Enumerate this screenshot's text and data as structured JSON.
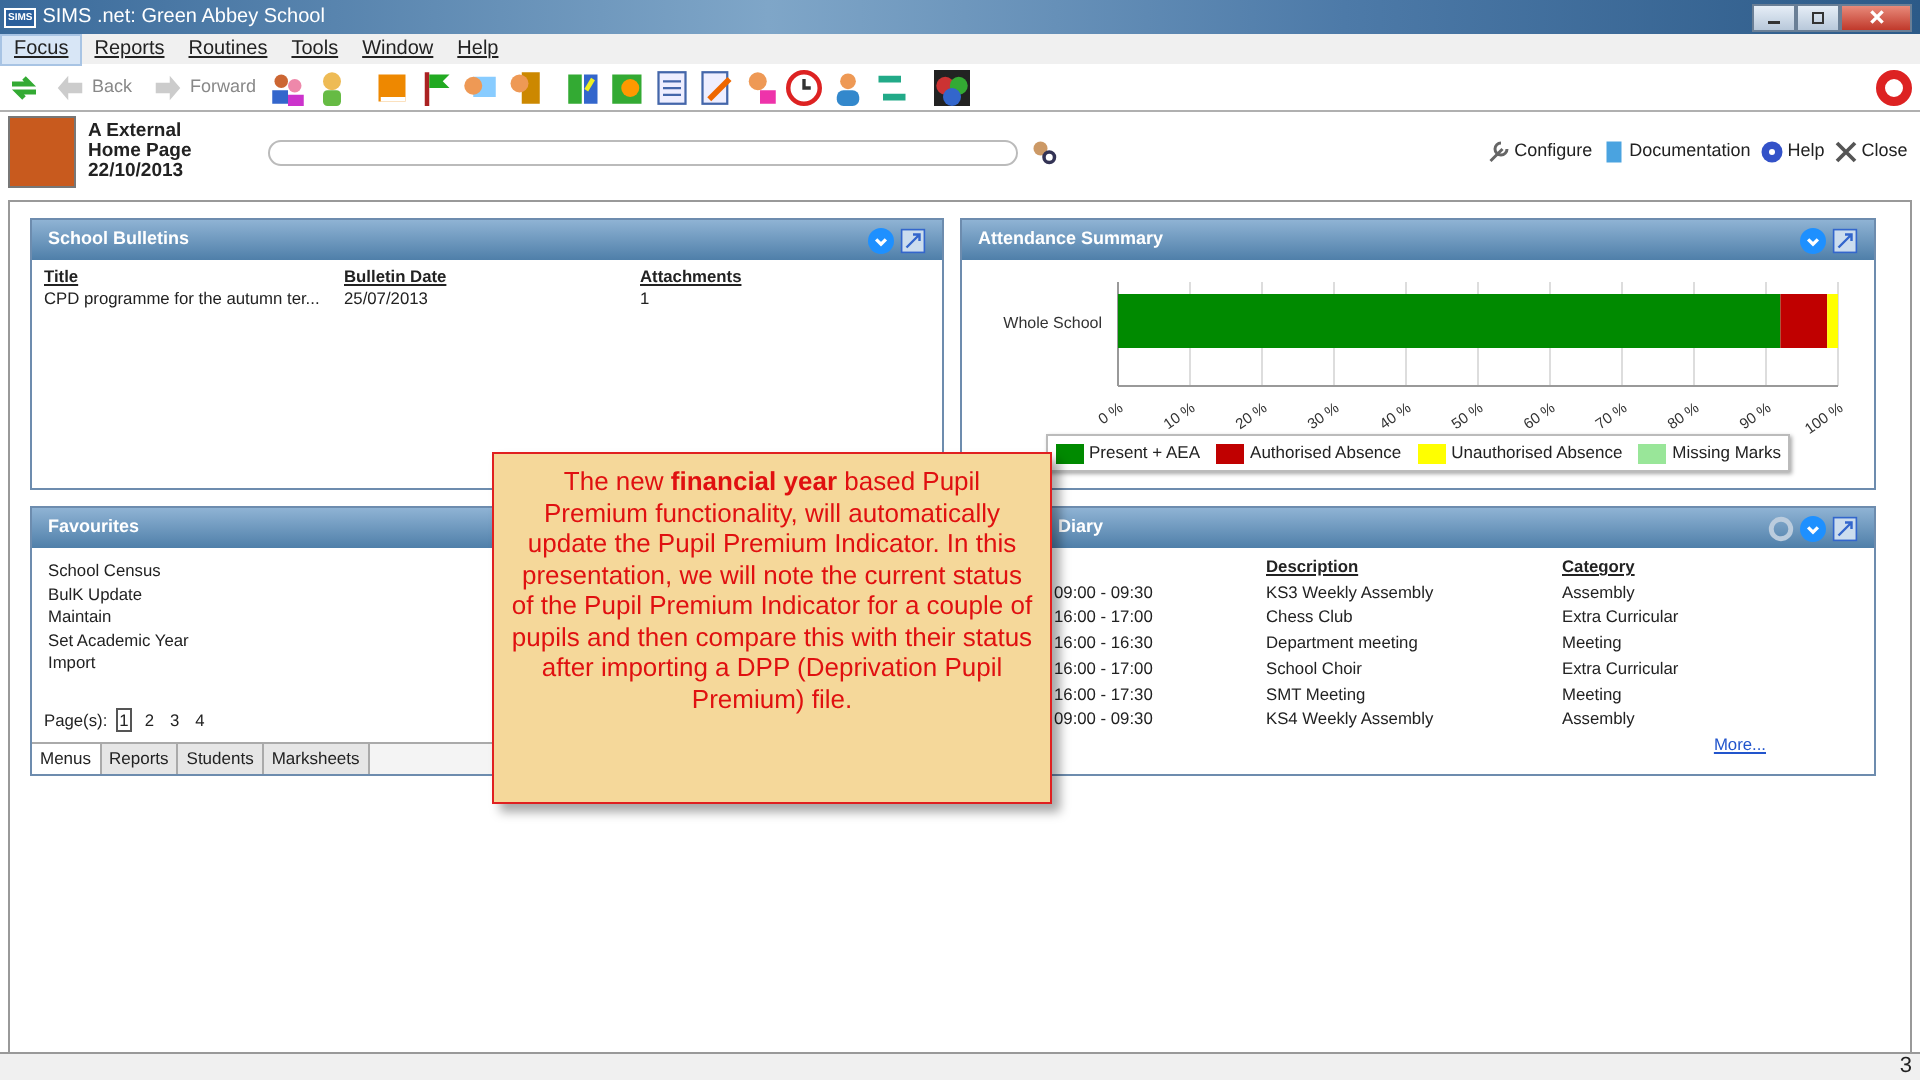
{
  "window": {
    "title": "SIMS .net: Green Abbey School",
    "app_badge": "SIMS"
  },
  "menu": [
    {
      "label": "Focus",
      "selected": true
    },
    {
      "label": "Reports",
      "selected": false
    },
    {
      "label": "Routines",
      "selected": false
    },
    {
      "label": "Tools",
      "selected": false
    },
    {
      "label": "Window",
      "selected": false
    },
    {
      "label": "Help",
      "selected": false
    }
  ],
  "toolbar": {
    "nav": [
      {
        "label": "Back",
        "disabled": true
      },
      {
        "label": "Forward",
        "disabled": true
      }
    ]
  },
  "header": {
    "lines": [
      "A External",
      "Home Page",
      "22/10/2013"
    ],
    "links": [
      {
        "label": "Configure",
        "kind": "wrench"
      },
      {
        "label": "Documentation",
        "kind": "document"
      },
      {
        "label": "Help",
        "kind": "help"
      },
      {
        "label": "Close",
        "kind": "close"
      }
    ]
  },
  "bulletins": {
    "title": "School Bulletins",
    "columns": [
      "Title",
      "Bulletin Date",
      "Attachments"
    ],
    "rows": [
      [
        "CPD programme for the autumn ter...",
        "25/07/2013",
        "1"
      ]
    ]
  },
  "attendance": {
    "title": "Attendance Summary",
    "chart_data": {
      "type": "bar",
      "orientation": "horizontal",
      "stacked": true,
      "categories": [
        "Whole School"
      ],
      "series": [
        {
          "name": "Present + AEA",
          "color": "#008a00",
          "values": [
            92
          ]
        },
        {
          "name": "Authorised Absence",
          "color": "#c00000",
          "values": [
            6.5
          ]
        },
        {
          "name": "Unauthorised Absence",
          "color": "#ffff00",
          "values": [
            1.5
          ]
        },
        {
          "name": "Missing Marks",
          "color": "#99e699",
          "values": [
            0
          ]
        }
      ],
      "xlim": [
        0,
        100
      ],
      "grid": true,
      "legend": true,
      "xticks": [
        {
          "value": 0,
          "label": "0 %"
        },
        {
          "value": 10,
          "label": "10 %"
        },
        {
          "value": 20,
          "label": "20 %"
        },
        {
          "value": 30,
          "label": "30 %"
        },
        {
          "value": 40,
          "label": "40 %"
        },
        {
          "value": 50,
          "label": "50 %"
        },
        {
          "value": 60,
          "label": "60 %"
        },
        {
          "value": 70,
          "label": "70 %"
        },
        {
          "value": 80,
          "label": "80 %"
        },
        {
          "value": 90,
          "label": "90 %"
        },
        {
          "value": 100,
          "label": "100 %"
        }
      ]
    }
  },
  "favourites": {
    "title": "Favourites",
    "items": [
      "School Census",
      "BulK Update",
      "Maintain",
      "Set Academic Year",
      "Import"
    ],
    "pages_label": "Page(s):",
    "pages": [
      {
        "label": "1",
        "selected": true
      },
      {
        "label": "2",
        "selected": false
      },
      {
        "label": "3",
        "selected": false
      },
      {
        "label": "4",
        "selected": false
      }
    ],
    "tabs": [
      {
        "label": "Menus",
        "selected": true
      },
      {
        "label": "Reports",
        "selected": false
      },
      {
        "label": "Students",
        "selected": false
      },
      {
        "label": "Marksheets",
        "selected": false
      }
    ]
  },
  "diary": {
    "title": "Diary",
    "columns": [
      "",
      "Description",
      "Category"
    ],
    "rows": [
      [
        "09:00 - 09:30",
        "KS3 Weekly Assembly",
        "Assembly"
      ],
      [
        "16:00 - 17:00",
        "Chess Club",
        "Extra Curricular"
      ],
      [
        "16:00 - 16:30",
        "Department meeting",
        "Meeting"
      ],
      [
        "16:00 - 17:00",
        "School Choir",
        "Extra Curricular"
      ],
      [
        "16:00 - 17:30",
        "SMT Meeting",
        "Meeting"
      ],
      [
        "09:00 - 09:30",
        "KS4 Weekly Assembly",
        "Assembly"
      ]
    ],
    "more": "More..."
  },
  "callout": {
    "text": "The new **financial year** based Pupil Premium functionality, will automatically update the Pupil Premium Indicator. In this presentation, we will note the current status of the Pupil Premium Indicator for a couple of pupils and then compare this with their status after importing a DPP (Deprivation Pupil Premium) file."
  },
  "slide_number": "3"
}
